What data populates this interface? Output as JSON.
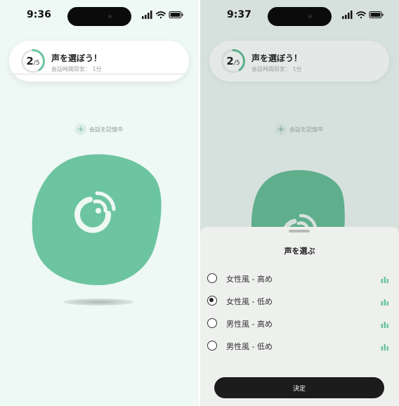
{
  "colors": {
    "accent": "#6cc5a0",
    "accent_dim": "#5fae8c",
    "left_bg": "#eef8f4",
    "right_bg": "#d6e1dd",
    "button": "#1c1c1c"
  },
  "left": {
    "status": {
      "time": "9:36"
    },
    "card": {
      "progress_current": "2",
      "progress_total": "/5",
      "progress_fraction": 0.4,
      "title": "声を選ぼう！",
      "subtitle": "会話時間目安： 1分"
    },
    "memory_label": "会話を記憶中",
    "main_icon": "voice-talk-icon"
  },
  "right": {
    "status": {
      "time": "9:37"
    },
    "card": {
      "progress_current": "2",
      "progress_total": "/5",
      "progress_fraction": 0.4,
      "title": "声を選ぼう！",
      "subtitle": "会話時間目安： 1分"
    },
    "memory_label": "会話を記憶中",
    "sheet": {
      "title": "声を選ぶ",
      "options": [
        {
          "label": "女性風 - 高め",
          "selected": false
        },
        {
          "label": "女性風 - 低め",
          "selected": true
        },
        {
          "label": "男性風 - 高め",
          "selected": false
        },
        {
          "label": "男性風 - 低め",
          "selected": false
        }
      ],
      "confirm_label": "決定"
    }
  },
  "icons": {
    "signal": "signal-bars-icon",
    "wifi": "wifi-icon",
    "battery": "battery-icon",
    "memory": "sparkle-icon",
    "audio_preview": "audio-bars-icon"
  }
}
